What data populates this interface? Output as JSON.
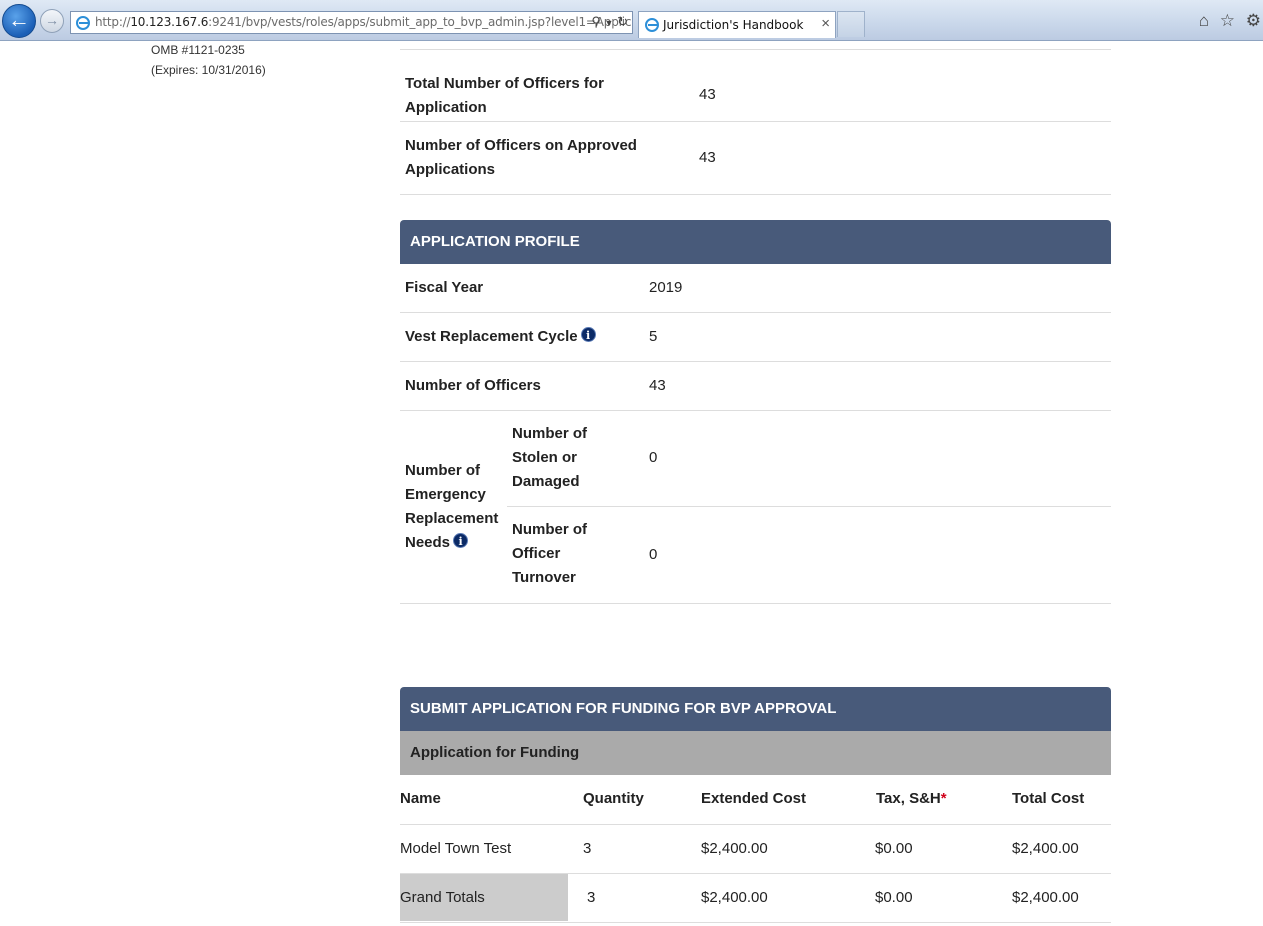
{
  "browser": {
    "url_prefix": "http://",
    "url_host": "10.123.167.6",
    "url_rest": ":9241/bvp/vests/roles/apps/submit_app_to_bvp_admin.jsp?level1=Applic",
    "tab_title": "Jurisdiction's Handbook",
    "icons": [
      "back-arrow-icon",
      "forward-arrow-icon",
      "ie-logo-icon",
      "search-icon",
      "dropdown-icon",
      "refresh-icon",
      "close-icon",
      "home-icon",
      "star-icon",
      "gear-icon"
    ]
  },
  "meta": {
    "omb": "OMB #1121-0235",
    "expires": "(Expires: 10/31/2016)"
  },
  "summary": [
    {
      "label_line1": "Total Number of Officers for",
      "label_line2": "Application",
      "value": "43"
    },
    {
      "label_line1": "Number of Officers on Approved",
      "label_line2": "Applications",
      "value": "43"
    }
  ],
  "profile": {
    "heading": "APPLICATION PROFILE",
    "fiscal_year_label": "Fiscal Year",
    "fiscal_year": "2019",
    "cycle_label": "Vest Replacement Cycle",
    "cycle": "5",
    "officers_label": "Number of Officers",
    "officers": "43",
    "emergency_label": [
      "Number of",
      "Emergency",
      "Replacement",
      "Needs"
    ],
    "stolen_label": [
      "Number of",
      "Stolen or",
      "Damaged"
    ],
    "stolen": "0",
    "turnover_label": [
      "Number of",
      "Officer",
      "Turnover"
    ],
    "turnover": "0"
  },
  "submit": {
    "heading": "SUBMIT APPLICATION FOR FUNDING FOR BVP APPROVAL",
    "subheading": "Application for Funding",
    "columns": {
      "name": "Name",
      "quantity": "Quantity",
      "extended": "Extended Cost",
      "tax": "Tax, S&H",
      "tax_req": "*",
      "total": "Total Cost"
    },
    "row": {
      "name": "Model Town Test",
      "quantity": "3",
      "extended": "$2,400.00",
      "tax": "$0.00",
      "total": "$2,400.00"
    },
    "grand": {
      "name": "Grand Totals",
      "quantity": "3",
      "extended": "$2,400.00",
      "tax": "$0.00",
      "total": "$2,400.00"
    }
  }
}
